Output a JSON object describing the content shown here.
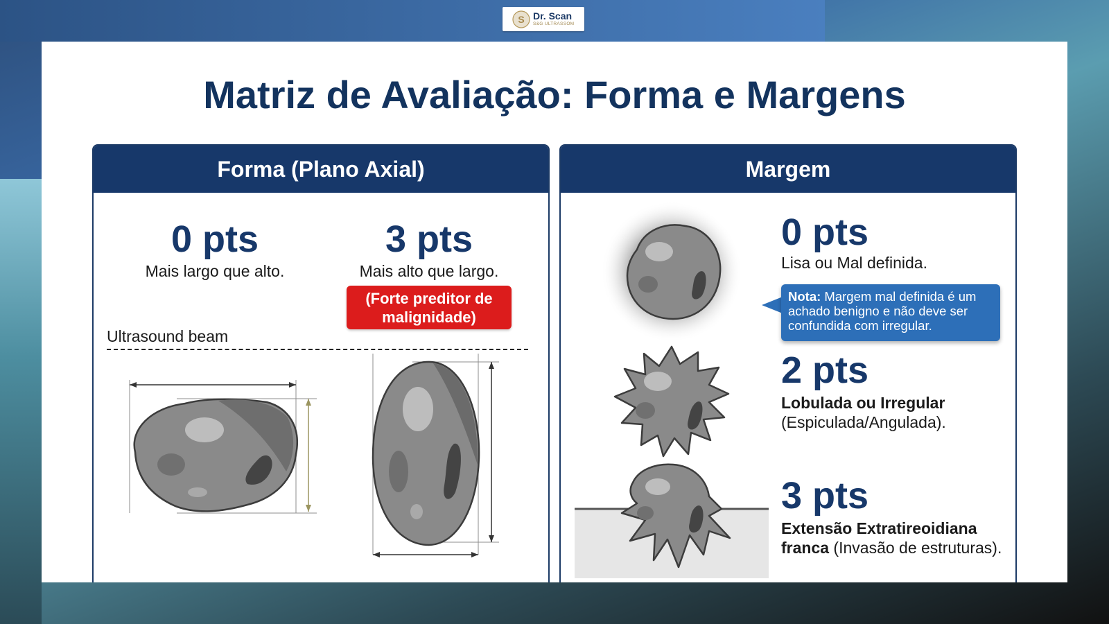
{
  "logo": {
    "name": "Dr. Scan",
    "sub": "S&G ULTRASSOM"
  },
  "title": "Matriz de Avaliação: Forma e Margens",
  "forma": {
    "header": "Forma (Plano Axial)",
    "col0": {
      "pts": "0 pts",
      "desc": "Mais largo que alto."
    },
    "col3": {
      "pts": "3 pts",
      "desc": "Mais alto que largo.",
      "warning": "(Forte preditor de malignidade)"
    },
    "beam_label": "Ultrasound beam"
  },
  "margem": {
    "header": "Margem",
    "item0": {
      "pts": "0 pts",
      "desc": "Lisa ou Mal definida.",
      "note_label": "Nota:",
      "note_text": " Margem mal definida é um achado benigno e não deve ser confundida com irregular."
    },
    "item2": {
      "pts": "2 pts",
      "bold": "Lobulada ou Irregular",
      "desc": "(Espiculada/Angulada)."
    },
    "item3": {
      "pts": "3 pts",
      "bold1": "Extensão Extratireoidiana",
      "bold2": "franca",
      "desc": " (Invasão de estruturas)."
    }
  },
  "colors": {
    "navy": "#17386a",
    "warning_red": "#dc1c1c",
    "note_blue": "#2d6fb8",
    "nodule_gray": "#8a8a8a"
  }
}
